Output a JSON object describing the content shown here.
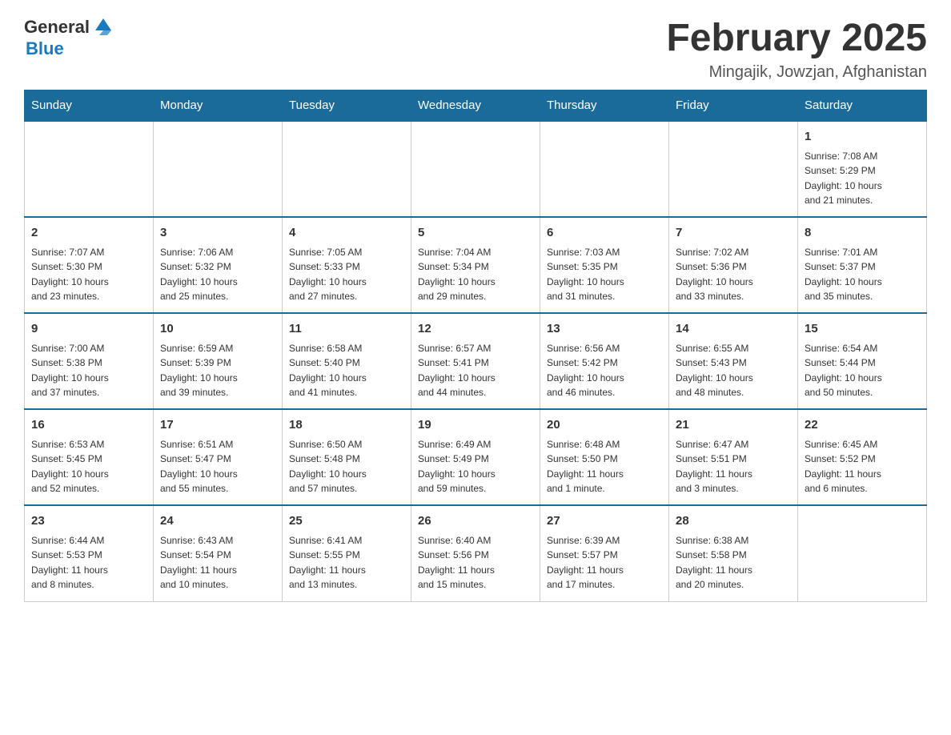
{
  "logo": {
    "general": "General",
    "blue": "Blue",
    "icon_color": "#1a7abf"
  },
  "title": "February 2025",
  "subtitle": "Mingajik, Jowzjan, Afghanistan",
  "days_of_week": [
    "Sunday",
    "Monday",
    "Tuesday",
    "Wednesday",
    "Thursday",
    "Friday",
    "Saturday"
  ],
  "weeks": [
    [
      {
        "day": "",
        "info": ""
      },
      {
        "day": "",
        "info": ""
      },
      {
        "day": "",
        "info": ""
      },
      {
        "day": "",
        "info": ""
      },
      {
        "day": "",
        "info": ""
      },
      {
        "day": "",
        "info": ""
      },
      {
        "day": "1",
        "info": "Sunrise: 7:08 AM\nSunset: 5:29 PM\nDaylight: 10 hours\nand 21 minutes."
      }
    ],
    [
      {
        "day": "2",
        "info": "Sunrise: 7:07 AM\nSunset: 5:30 PM\nDaylight: 10 hours\nand 23 minutes."
      },
      {
        "day": "3",
        "info": "Sunrise: 7:06 AM\nSunset: 5:32 PM\nDaylight: 10 hours\nand 25 minutes."
      },
      {
        "day": "4",
        "info": "Sunrise: 7:05 AM\nSunset: 5:33 PM\nDaylight: 10 hours\nand 27 minutes."
      },
      {
        "day": "5",
        "info": "Sunrise: 7:04 AM\nSunset: 5:34 PM\nDaylight: 10 hours\nand 29 minutes."
      },
      {
        "day": "6",
        "info": "Sunrise: 7:03 AM\nSunset: 5:35 PM\nDaylight: 10 hours\nand 31 minutes."
      },
      {
        "day": "7",
        "info": "Sunrise: 7:02 AM\nSunset: 5:36 PM\nDaylight: 10 hours\nand 33 minutes."
      },
      {
        "day": "8",
        "info": "Sunrise: 7:01 AM\nSunset: 5:37 PM\nDaylight: 10 hours\nand 35 minutes."
      }
    ],
    [
      {
        "day": "9",
        "info": "Sunrise: 7:00 AM\nSunset: 5:38 PM\nDaylight: 10 hours\nand 37 minutes."
      },
      {
        "day": "10",
        "info": "Sunrise: 6:59 AM\nSunset: 5:39 PM\nDaylight: 10 hours\nand 39 minutes."
      },
      {
        "day": "11",
        "info": "Sunrise: 6:58 AM\nSunset: 5:40 PM\nDaylight: 10 hours\nand 41 minutes."
      },
      {
        "day": "12",
        "info": "Sunrise: 6:57 AM\nSunset: 5:41 PM\nDaylight: 10 hours\nand 44 minutes."
      },
      {
        "day": "13",
        "info": "Sunrise: 6:56 AM\nSunset: 5:42 PM\nDaylight: 10 hours\nand 46 minutes."
      },
      {
        "day": "14",
        "info": "Sunrise: 6:55 AM\nSunset: 5:43 PM\nDaylight: 10 hours\nand 48 minutes."
      },
      {
        "day": "15",
        "info": "Sunrise: 6:54 AM\nSunset: 5:44 PM\nDaylight: 10 hours\nand 50 minutes."
      }
    ],
    [
      {
        "day": "16",
        "info": "Sunrise: 6:53 AM\nSunset: 5:45 PM\nDaylight: 10 hours\nand 52 minutes."
      },
      {
        "day": "17",
        "info": "Sunrise: 6:51 AM\nSunset: 5:47 PM\nDaylight: 10 hours\nand 55 minutes."
      },
      {
        "day": "18",
        "info": "Sunrise: 6:50 AM\nSunset: 5:48 PM\nDaylight: 10 hours\nand 57 minutes."
      },
      {
        "day": "19",
        "info": "Sunrise: 6:49 AM\nSunset: 5:49 PM\nDaylight: 10 hours\nand 59 minutes."
      },
      {
        "day": "20",
        "info": "Sunrise: 6:48 AM\nSunset: 5:50 PM\nDaylight: 11 hours\nand 1 minute."
      },
      {
        "day": "21",
        "info": "Sunrise: 6:47 AM\nSunset: 5:51 PM\nDaylight: 11 hours\nand 3 minutes."
      },
      {
        "day": "22",
        "info": "Sunrise: 6:45 AM\nSunset: 5:52 PM\nDaylight: 11 hours\nand 6 minutes."
      }
    ],
    [
      {
        "day": "23",
        "info": "Sunrise: 6:44 AM\nSunset: 5:53 PM\nDaylight: 11 hours\nand 8 minutes."
      },
      {
        "day": "24",
        "info": "Sunrise: 6:43 AM\nSunset: 5:54 PM\nDaylight: 11 hours\nand 10 minutes."
      },
      {
        "day": "25",
        "info": "Sunrise: 6:41 AM\nSunset: 5:55 PM\nDaylight: 11 hours\nand 13 minutes."
      },
      {
        "day": "26",
        "info": "Sunrise: 6:40 AM\nSunset: 5:56 PM\nDaylight: 11 hours\nand 15 minutes."
      },
      {
        "day": "27",
        "info": "Sunrise: 6:39 AM\nSunset: 5:57 PM\nDaylight: 11 hours\nand 17 minutes."
      },
      {
        "day": "28",
        "info": "Sunrise: 6:38 AM\nSunset: 5:58 PM\nDaylight: 11 hours\nand 20 minutes."
      },
      {
        "day": "",
        "info": ""
      }
    ]
  ]
}
